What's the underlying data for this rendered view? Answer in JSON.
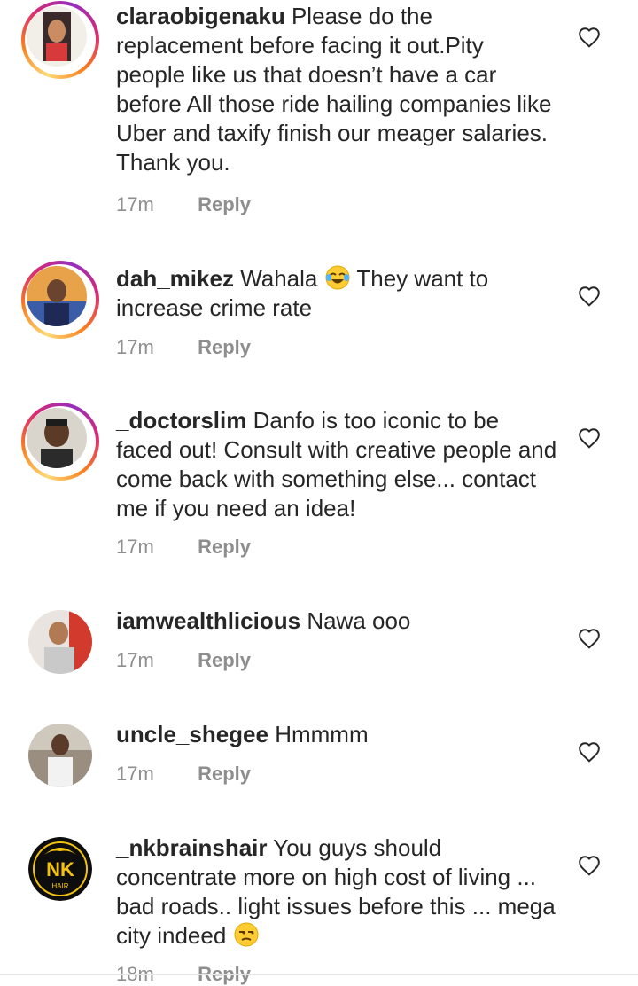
{
  "comments": [
    {
      "username": "claraobigenaku",
      "text": "Please do the replacement before facing it out.Pity people like us that doesn’t have a car before All those ride hailing companies like Uber and taxify finish our meager salaries. Thank you.",
      "time": "17m",
      "reply_label": "Reply",
      "story_ring": true
    },
    {
      "username": "dah_mikez",
      "text_before_emoji": "Wahala",
      "emoji": "face-with-tears-of-joy",
      "text_after_emoji": "They want to increase crime rate",
      "time": "17m",
      "reply_label": "Reply",
      "story_ring": true
    },
    {
      "username": "_doctorslim",
      "text": "Danfo is too iconic to be faced out! Consult with creative people and come back with something else... contact me if you need an idea!",
      "time": "17m",
      "reply_label": "Reply",
      "story_ring": true
    },
    {
      "username": "iamwealthlicious",
      "text": "Nawa ooo",
      "time": "17m",
      "reply_label": "Reply",
      "story_ring": false
    },
    {
      "username": "uncle_shegee",
      "text": "Hmmmm",
      "time": "17m",
      "reply_label": "Reply",
      "story_ring": false
    },
    {
      "username": "_nkbrainshair",
      "text": "You guys should concentrate more on high cost of living ... bad roads.. light issues before this ... mega city indeed",
      "emoji": "unamused-face",
      "time": "18m",
      "reply_label": "Reply",
      "story_ring": false,
      "avatar_logo_text": "NK",
      "avatar_logo_subtext": "HAIR"
    }
  ],
  "icons": {
    "like": "heart-outline-icon"
  },
  "colors": {
    "text": "#262626",
    "meta": "#8e8e8e",
    "ring_start": "#feda75",
    "ring_end": "#d62976"
  }
}
